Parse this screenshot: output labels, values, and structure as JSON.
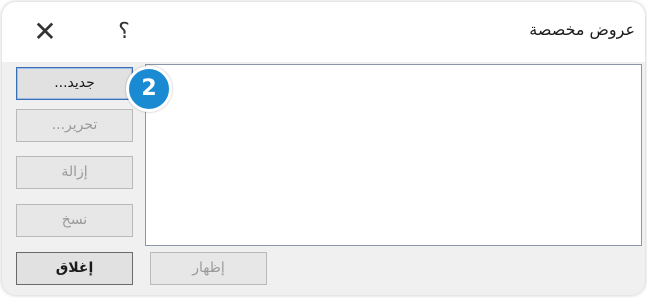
{
  "dialog": {
    "title": "عروض مخصصة",
    "close_glyph": "✕",
    "help_glyph": "؟"
  },
  "buttons": {
    "new": "جديد...",
    "edit": "تحرير...",
    "remove": "إزالة",
    "copy": "نسخ",
    "close": "إغلاق",
    "show": "إظهار"
  },
  "callout": {
    "number": "2",
    "color": "#1a8bd2"
  }
}
